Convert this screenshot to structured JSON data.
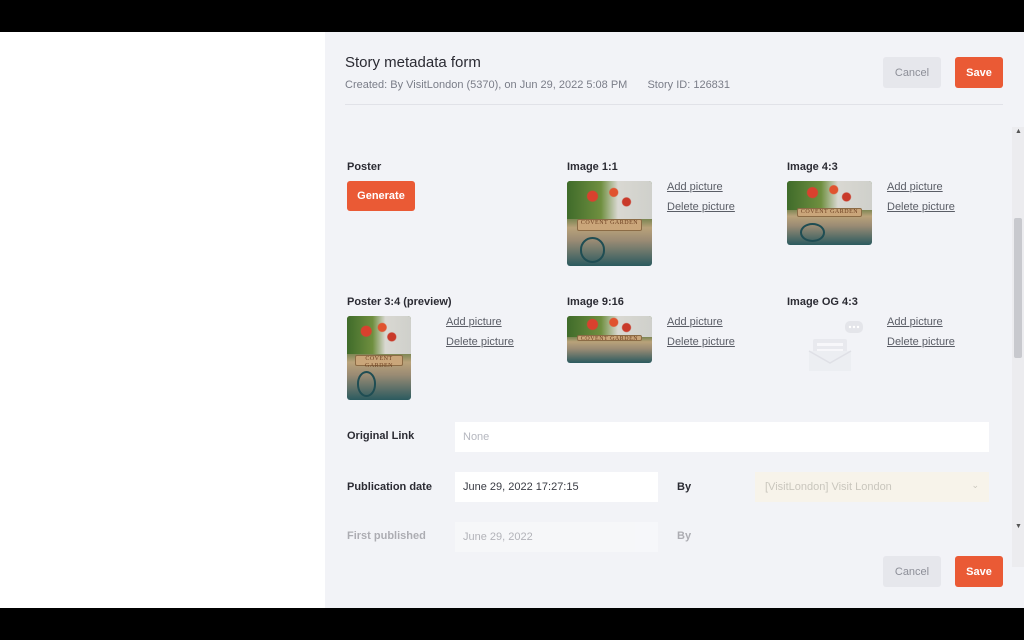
{
  "header": {
    "title": "Story metadata form",
    "created_label": "Created:",
    "created_value": "By VisitLondon (5370), on Jun 29, 2022 5:08 PM",
    "story_id_label": "Story ID:",
    "story_id_value": "126831"
  },
  "buttons": {
    "cancel": "Cancel",
    "save": "Save",
    "generate": "Generate"
  },
  "images": {
    "poster_label": "Poster",
    "image_1_1_label": "Image 1:1",
    "image_4_3_label": "Image 4:3",
    "poster_3_4_label": "Poster 3:4 (preview)",
    "image_9_16_label": "Image 9:16",
    "image_og_4_3_label": "Image OG 4:3",
    "add_picture": "Add picture",
    "delete_picture": "Delete picture",
    "sign_text": "COVENT GARDEN"
  },
  "fields": {
    "original_link_label": "Original Link",
    "original_link_placeholder": "None",
    "publication_date_label": "Publication date",
    "publication_date_value": "June 29, 2022 17:27:15",
    "by_label": "By",
    "by_value": "[VisitLondon] Visit London",
    "first_published_label": "First published",
    "first_published_value": "June 29, 2022",
    "row_cut_label": "By"
  },
  "colors": {
    "accent": "#ea5a35",
    "panel_bg": "#f2f3f7"
  }
}
